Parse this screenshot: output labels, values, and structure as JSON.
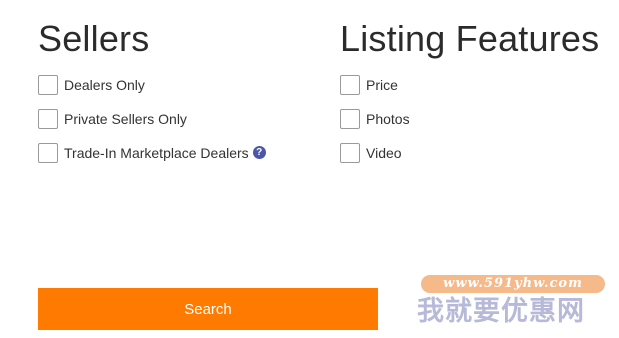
{
  "sellers": {
    "heading": "Sellers",
    "options": [
      {
        "label": "Dealers Only",
        "checked": false
      },
      {
        "label": "Private Sellers Only",
        "checked": false
      },
      {
        "label": "Trade-In Marketplace Dealers",
        "checked": false,
        "help_icon": "question-circle-icon",
        "help_glyph": "?"
      }
    ]
  },
  "features": {
    "heading": "Listing Features",
    "options": [
      {
        "label": "Price",
        "checked": false
      },
      {
        "label": "Photos",
        "checked": false
      },
      {
        "label": "Video",
        "checked": false
      }
    ]
  },
  "search_button": {
    "label": "Search",
    "color": "#ff7a00"
  },
  "watermark": {
    "url": "www.591yhw.com",
    "text": "我就要优惠网"
  }
}
